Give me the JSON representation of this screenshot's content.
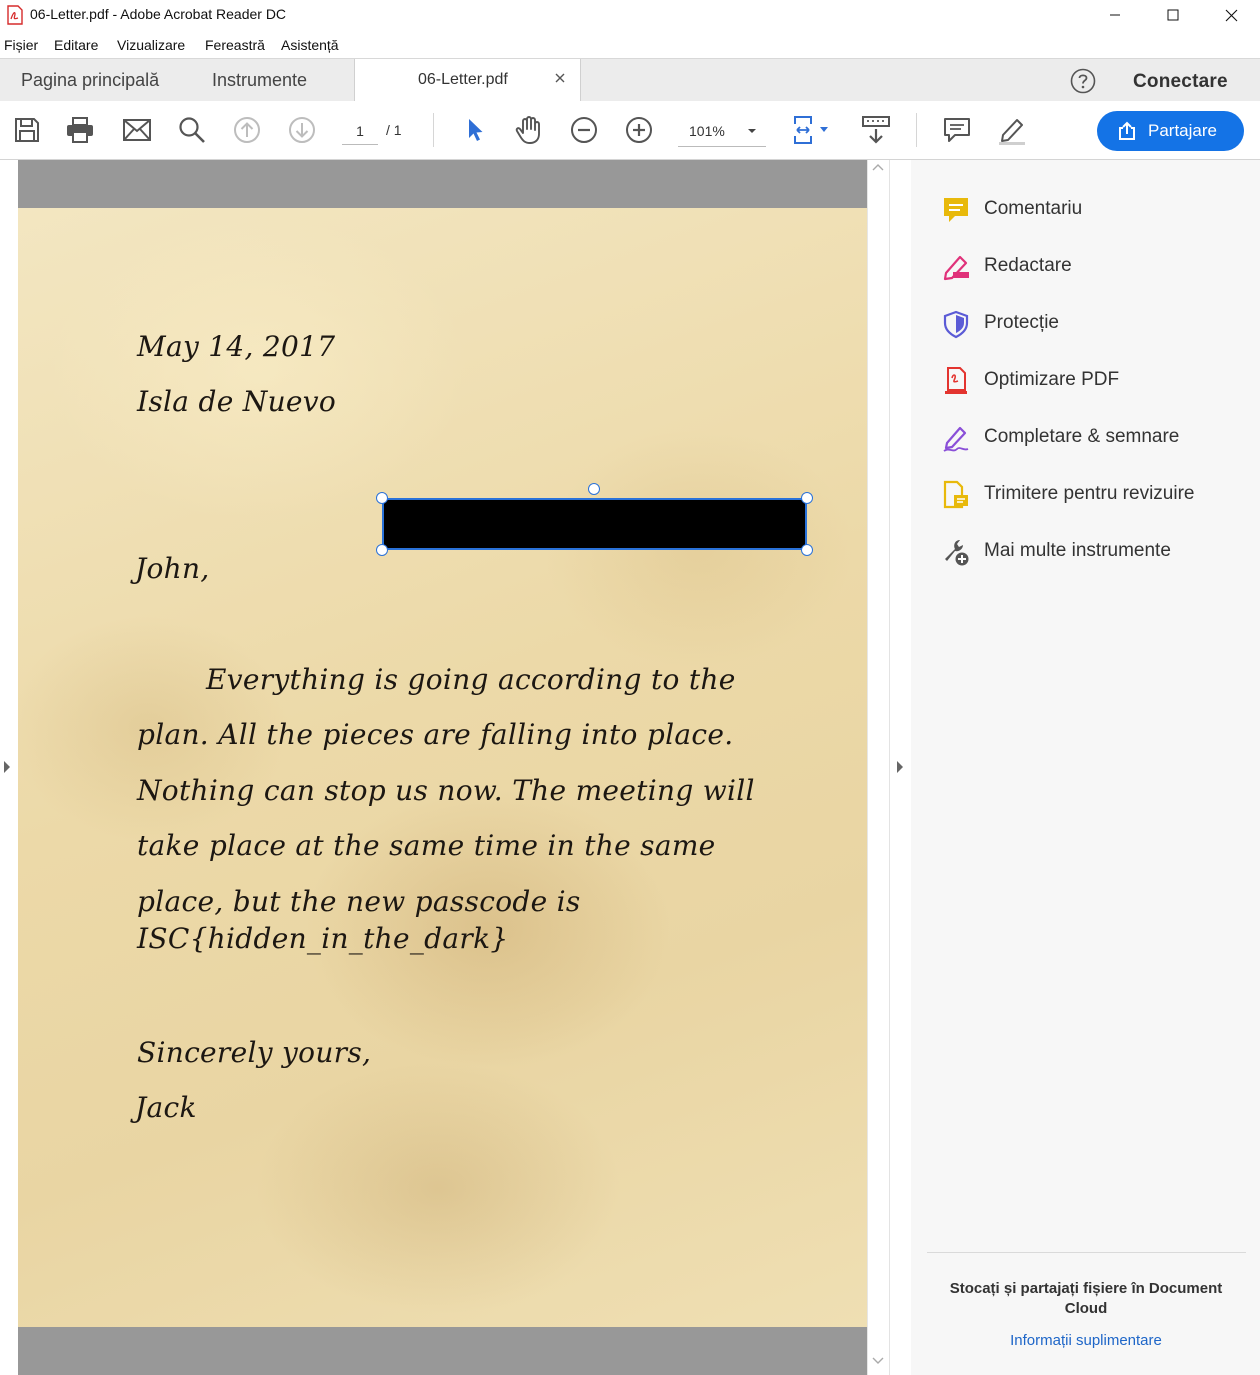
{
  "window": {
    "title": "06-Letter.pdf - Adobe Acrobat Reader DC",
    "controls": [
      "minimize",
      "maximize",
      "close"
    ]
  },
  "menu": [
    "Fișier",
    "Editare",
    "Vizualizare",
    "Fereastră",
    "Asistență"
  ],
  "tabs": {
    "home": "Pagina principală",
    "tools": "Instrumente",
    "document": "06-Letter.pdf",
    "login": "Conectare"
  },
  "toolbar": {
    "page_current": "1",
    "page_total": "/ 1",
    "zoom": "101%",
    "share_label": "Partajare"
  },
  "document": {
    "date": "May 14, 2017",
    "place": "Isla de Nuevo",
    "salutation": "John,",
    "body_lines": [
      "Everything is going according to the",
      "plan. All the pieces are falling into place.",
      "Nothing can stop us now. The meeting will",
      "take place at the same time in the same",
      "place, but the new passcode is",
      "ISC{hidden_in_the_dark}"
    ],
    "closing": "Sincerely yours,",
    "signature": "Jack"
  },
  "tools_panel": {
    "items": [
      {
        "label": "Comentariu",
        "icon": "comment-icon",
        "color": "#e8b90b"
      },
      {
        "label": "Redactare",
        "icon": "redact-icon",
        "color": "#e0327a"
      },
      {
        "label": "Protecție",
        "icon": "shield-icon",
        "color": "#5b5bd6"
      },
      {
        "label": "Optimizare PDF",
        "icon": "optimize-pdf-icon",
        "color": "#e3342f"
      },
      {
        "label": "Completare & semnare",
        "icon": "fill-sign-icon",
        "color": "#8a4fd8"
      },
      {
        "label": "Trimitere pentru revizuire",
        "icon": "send-review-icon",
        "color": "#e8b90b"
      },
      {
        "label": "Mai multe instrumente",
        "icon": "more-tools-icon",
        "color": "#555555"
      }
    ],
    "cloud_text": "Stocați și partajați fișiere în Document Cloud",
    "cloud_link": "Informații suplimentare"
  },
  "colors": {
    "accent": "#1473e6",
    "selection": "#2a72d9",
    "paper": "#ecd9a8"
  }
}
